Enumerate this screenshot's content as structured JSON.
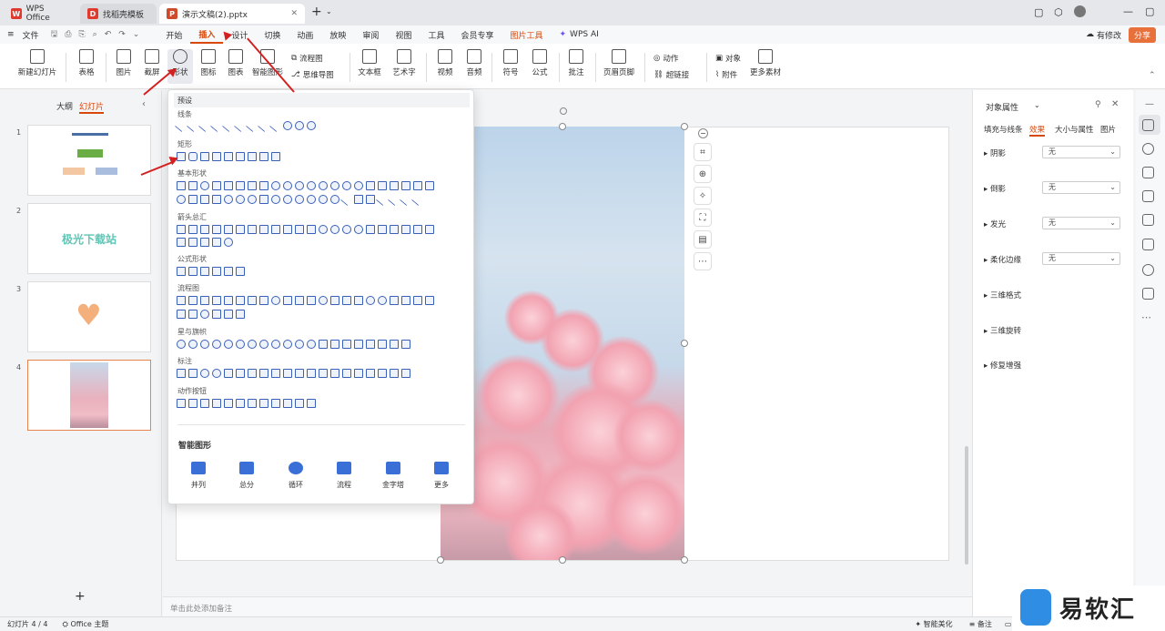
{
  "tabs": [
    {
      "label": "WPS Office",
      "icon": "wps-logo-icon"
    },
    {
      "label": "找稻壳模板",
      "icon": "docer-logo-icon"
    },
    {
      "label": "演示文稿(2).pptx",
      "icon": "ppt-logo-icon"
    }
  ],
  "menu": {
    "file": "文件",
    "items": [
      "开始",
      "插入",
      "设计",
      "切换",
      "动画",
      "放映",
      "审阅",
      "视图",
      "工具",
      "会员专享",
      "图片工具"
    ],
    "active": "插入",
    "wps_ai": "WPS AI",
    "edit_status": "有修改",
    "share": "分享"
  },
  "ribbon": {
    "new_slide": "新建幻灯片",
    "table": "表格",
    "picture": "图片",
    "screenshot": "截屏",
    "shape": "形状",
    "icon": "图标",
    "chart": "图表",
    "smartart": "智能图形",
    "flowchart": "流程图",
    "mindmap": "思维导图",
    "textbox": "文本框",
    "wordart": "艺术字",
    "video": "视频",
    "audio": "音频",
    "symbol": "符号",
    "formula": "公式",
    "comment": "批注",
    "header_footer": "页眉页脚",
    "action": "动作",
    "hyperlink": "超链接",
    "object": "对象",
    "attachment": "附件",
    "more": "更多素材"
  },
  "left_panel": {
    "outline": "大纲",
    "slides": "幻灯片",
    "slide_numbers": [
      "1",
      "2",
      "3",
      "4"
    ],
    "slide2_text": "极光下载站"
  },
  "dropdown": {
    "preset": "预设",
    "categories": [
      "线条",
      "矩形",
      "基本形状",
      "箭头总汇",
      "公式形状",
      "流程图",
      "星与旗帜",
      "标注",
      "动作按钮"
    ],
    "smart_title": "智能图形",
    "smart_items": [
      "并列",
      "总分",
      "循环",
      "流程",
      "金字塔",
      "更多"
    ]
  },
  "right_panel": {
    "title": "对象属性",
    "tabs": [
      "填充与线条",
      "效果",
      "大小与属性",
      "图片"
    ],
    "active_tab": "效果",
    "props": [
      {
        "label": "阴影",
        "value": "无"
      },
      {
        "label": "倒影",
        "value": "无"
      },
      {
        "label": "发光",
        "value": "无"
      },
      {
        "label": "柔化边缘",
        "value": "无"
      }
    ],
    "sections": [
      "三维格式",
      "三维旋转",
      "修复增强"
    ]
  },
  "notes_placeholder": "单击此处添加备注",
  "status": {
    "slide_info": "幻灯片 4 / 4",
    "theme": "Office 主题",
    "beautify": "智能美化",
    "notes": "备注",
    "comment": "批注"
  },
  "watermark": "易软汇",
  "colors": {
    "accent": "#d9470b",
    "shape_blue": "#3a5fb8",
    "arrow_red": "#d32020"
  }
}
